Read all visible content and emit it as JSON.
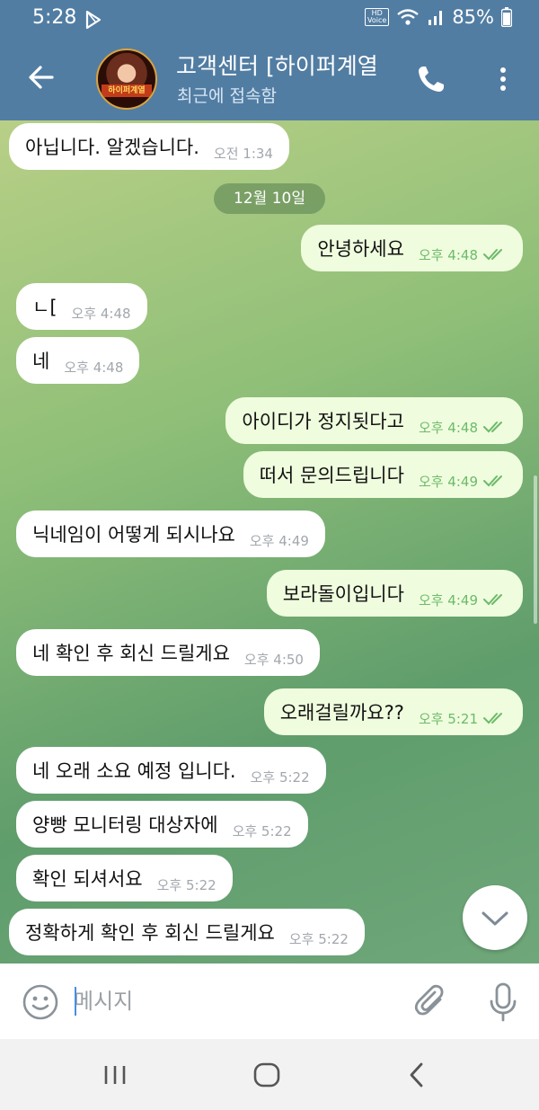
{
  "status_bar": {
    "time": "5:28",
    "battery": "85%",
    "hd_voice": "HD\nVoice"
  },
  "header": {
    "title": "고객센터 [하이퍼계열",
    "subtitle": "최근에 접속함",
    "avatar_badge": "하이퍼계열"
  },
  "chat": {
    "date_divider": "12월 10일",
    "messages": [
      {
        "dir": "in",
        "text": "아닙니다. 알겠습니다.",
        "time": "오전 1:34"
      },
      {
        "dir": "out",
        "text": "안녕하세요",
        "time": "오후 4:48",
        "read": true
      },
      {
        "dir": "in",
        "text": "ㄴ[",
        "time": "오후 4:48"
      },
      {
        "dir": "in",
        "text": "네",
        "time": "오후 4:48"
      },
      {
        "dir": "out",
        "text": "아이디가 정지됫다고",
        "time": "오후 4:48",
        "read": true
      },
      {
        "dir": "out",
        "text": "떠서 문의드립니다",
        "time": "오후 4:49",
        "read": true
      },
      {
        "dir": "in",
        "text": "닉네임이 어떻게 되시나요",
        "time": "오후 4:49"
      },
      {
        "dir": "out",
        "text": "보라돌이입니다",
        "time": "오후 4:49",
        "read": true
      },
      {
        "dir": "in",
        "text": "네 확인 후 회신 드릴게요",
        "time": "오후 4:50"
      },
      {
        "dir": "out",
        "text": "오래걸릴까요??",
        "time": "오후 5:21",
        "read": true
      },
      {
        "dir": "in",
        "text": "네 오래 소요 예정 입니다.",
        "time": "오후 5:22"
      },
      {
        "dir": "in",
        "text": "양빵 모니터링 대상자에",
        "time": "오후 5:22"
      },
      {
        "dir": "in",
        "text": "확인 되셔서요",
        "time": "오후 5:22"
      },
      {
        "dir": "in",
        "text": "정확하게 확인 후 회신 드릴게요",
        "time": "오후 5:22"
      }
    ]
  },
  "composer": {
    "placeholder": "메시지"
  },
  "icons": {
    "back": "arrow-left-icon",
    "call": "phone-icon",
    "more": "more-vertical-icon",
    "emoji": "emoji-icon",
    "attach": "paperclip-icon",
    "mic": "microphone-icon",
    "scroll_down": "chevron-down-icon",
    "read_receipt": "double-check-icon"
  },
  "colors": {
    "header_bg": "#527da3",
    "incoming_bubble": "#ffffff",
    "outgoing_bubble": "#effdde",
    "outgoing_meta": "#6dba6a",
    "incoming_meta": "#a2a7ad"
  }
}
